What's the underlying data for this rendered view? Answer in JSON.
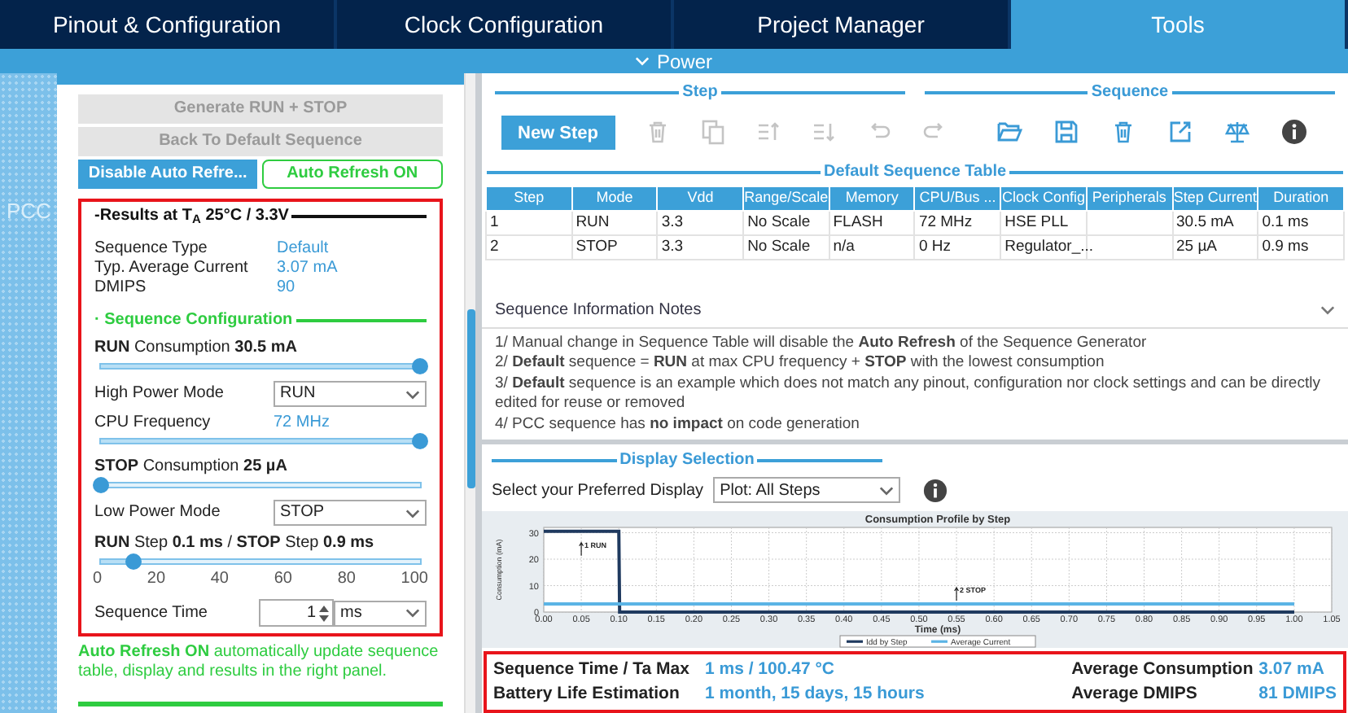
{
  "tabs": [
    {
      "label": "Pinout & Configuration",
      "selected": false
    },
    {
      "label": "Clock Configuration",
      "selected": false
    },
    {
      "label": "Project Manager",
      "selected": false
    },
    {
      "label": "Tools",
      "selected": true
    }
  ],
  "section": {
    "title": "Power",
    "expanded": true
  },
  "sidebar": {
    "label": "PCC"
  },
  "left_panel": {
    "button_rows": [
      [
        {
          "label": "Generate RUN + STOP",
          "kind": "disabled"
        }
      ],
      [
        {
          "label": "Back To Default Sequence",
          "kind": "disabled"
        }
      ],
      [
        {
          "label": "Disable Auto Refre...",
          "kind": "primary"
        },
        {
          "label": "Auto Refresh ON",
          "kind": "outline"
        }
      ]
    ],
    "results": {
      "highlighted": true,
      "title": "-Results at T$_{A}$ 25°C / 3.3V",
      "rows": [
        {
          "label": "Sequence Type",
          "value": "Default"
        },
        {
          "label": "Typ. Average Current",
          "value": "3.07 mA"
        },
        {
          "label": "DMIPS",
          "value": "90"
        }
      ],
      "config_title": "· Sequence Configuration",
      "items": [
        {
          "kind": "slider",
          "label": "**RUN** Consumption **30.5 mA**",
          "level": 1.0
        },
        {
          "kind": "select",
          "label": "High Power Mode",
          "value": "RUN"
        },
        {
          "kind": "value",
          "label": "CPU Frequency",
          "value": "72 MHz"
        },
        {
          "kind": "slider",
          "level": 1.0
        },
        {
          "kind": "slider",
          "label": "**STOP** Consumption **25 µA**",
          "level": 0.0
        },
        {
          "kind": "select",
          "label": "Low Power Mode",
          "value": "STOP"
        },
        {
          "kind": "slider",
          "label": "**RUN** Step **0.1 ms** / **STOP** Step **0.9 ms**",
          "level": 0.1,
          "ticks": [
            "0",
            "20",
            "40",
            "60",
            "80",
            "100"
          ]
        },
        {
          "kind": "spinner",
          "label": "Sequence Time",
          "value": "1",
          "unit": "ms"
        }
      ]
    },
    "note": "**Auto Refresh ON** automatically update sequence table, display and results in the right panel."
  },
  "step_group": {
    "title": "Step",
    "button": "New Step",
    "tools": [
      {
        "kind": "delete",
        "disabled": true
      },
      {
        "kind": "copy",
        "disabled": true
      },
      {
        "kind": "move-up",
        "disabled": true
      },
      {
        "kind": "move-down",
        "disabled": true
      },
      {
        "kind": "undo",
        "disabled": true
      },
      {
        "kind": "redo",
        "disabled": true
      }
    ]
  },
  "sequence_group": {
    "title": "Sequence",
    "tools": [
      {
        "kind": "open",
        "disabled": false
      },
      {
        "kind": "save",
        "disabled": false
      },
      {
        "kind": "delete",
        "disabled": false
      },
      {
        "kind": "export",
        "disabled": false
      },
      {
        "kind": "compare",
        "disabled": false
      },
      {
        "kind": "info",
        "disabled": false
      }
    ]
  },
  "table": {
    "title": "Default Sequence Table",
    "columns": [
      "Step",
      "Mode",
      "Vdd",
      "Range/Scale",
      "Memory",
      "CPU/Bus ...",
      "Clock Config",
      "Peripherals",
      "Step Current",
      "Duration"
    ],
    "rows": [
      [
        "1",
        "RUN",
        "3.3",
        "No Scale",
        "FLASH",
        "72 MHz",
        "HSE PLL",
        null,
        "30.5 mA",
        "0.1 ms"
      ],
      [
        "2",
        "STOP",
        "3.3",
        "No Scale",
        "n/a",
        "0 Hz",
        "Regulator_...",
        null,
        "25 µA",
        "0.9 ms"
      ]
    ]
  },
  "notes": {
    "title": "Sequence Information Notes",
    "expanded": true,
    "lines": [
      "1/ Manual change in Sequence Table will disable the **Auto Refresh** of the Sequence Generator",
      "2/ **Default** sequence = **RUN** at max CPU frequency + **STOP** with the lowest consumption",
      "3/ **Default** sequence is an example which does not match any pinout, configuration nor clock settings and can be directly edited for reuse or removed",
      "4/ PCC sequence has **no impact** on code generation"
    ]
  },
  "display": {
    "title": "Display Selection",
    "label": "Select your Preferred Display",
    "value": "Plot: All Steps",
    "chart_data": {
      "type": "line",
      "title": "Consumption Profile by Step",
      "xlabel": "Time (ms)",
      "ylabel": "Consumption (mA)",
      "x": [
        0,
        0.1,
        0.101,
        1.0
      ],
      "series": [
        {
          "name": "Idd by Step",
          "color": "#1f3a5f",
          "values": [
            30.5,
            30.5,
            0.025,
            0.025
          ]
        },
        {
          "name": "Average Current",
          "color": "#5bb4e5",
          "values": [
            3.07,
            3.07,
            3.07,
            3.07
          ]
        }
      ],
      "grid": true,
      "legend": "bottom",
      "xlim": [
        0,
        1.05
      ],
      "ylim": [
        0,
        32
      ],
      "xticks": [
        {
          "value": 0,
          "label": "0.00"
        },
        {
          "value": 0.05,
          "label": "0.05"
        },
        {
          "value": 0.1,
          "label": "0.10"
        },
        {
          "value": 0.15,
          "label": "0.15"
        },
        {
          "value": 0.2,
          "label": "0.20"
        },
        {
          "value": 0.25,
          "label": "0.25"
        },
        {
          "value": 0.3,
          "label": "0.30"
        },
        {
          "value": 0.35,
          "label": "0.35"
        },
        {
          "value": 0.4,
          "label": "0.40"
        },
        {
          "value": 0.45,
          "label": "0.45"
        },
        {
          "value": 0.5,
          "label": "0.50"
        },
        {
          "value": 0.55,
          "label": "0.55"
        },
        {
          "value": 0.6,
          "label": "0.60"
        },
        {
          "value": 0.65,
          "label": "0.65"
        },
        {
          "value": 0.7,
          "label": "0.70"
        },
        {
          "value": 0.75,
          "label": "0.75"
        },
        {
          "value": 0.8,
          "label": "0.80"
        },
        {
          "value": 0.85,
          "label": "0.85"
        },
        {
          "value": 0.9,
          "label": "0.90"
        },
        {
          "value": 0.95,
          "label": "0.95"
        },
        {
          "value": 1.0,
          "label": "1.00"
        },
        {
          "value": 1.05,
          "label": "1.05"
        }
      ],
      "yticks": [
        0,
        10,
        20,
        30
      ],
      "annotations": [
        "1 RUN",
        "2 STOP"
      ]
    }
  },
  "summary": {
    "highlighted": true,
    "left": [
      {
        "label": "Sequence Time / Ta Max",
        "value": "1 ms / 100.47 °C"
      },
      {
        "label": "Battery Life Estimation",
        "value": "1 month, 15 days, 15 hours"
      }
    ],
    "right": [
      {
        "label": "Average Consumption",
        "value": "3.07 mA"
      },
      {
        "label": "Average DMIPS",
        "value": "81 DMIPS"
      }
    ]
  }
}
